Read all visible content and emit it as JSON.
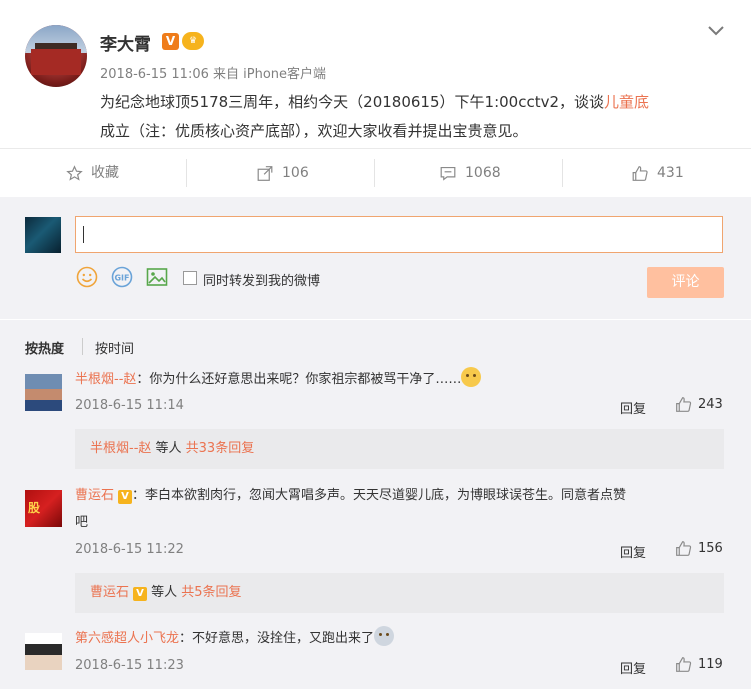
{
  "post": {
    "author": "李大霄",
    "verified_badge": "V",
    "meta": "2018-6-15 11:06 来自 iPhone客户端",
    "text_part1": "为纪念地球顶5178三周年，相约今天（20180615）下午1:00cctv2，谈谈",
    "text_link": "儿童底",
    "text_part2": "成立（注：优质核心资产底部），欢迎大家收看并提出宝贵意见。"
  },
  "actions": {
    "favorite": "收藏",
    "repost": "106",
    "comment": "1068",
    "like": "431"
  },
  "composer": {
    "input_value": "",
    "forward_label": "同时转发到我的微博",
    "submit": "评论"
  },
  "sort": {
    "hot": "按热度",
    "time": "按时间"
  },
  "comments": [
    {
      "name": "半根烟--赵",
      "sep": "：",
      "text": "你为什么还好意思出来呢？你家祖宗都被骂干净了……",
      "time": "2018-6-15 11:14",
      "reply": "回复",
      "likes": "243",
      "sub_name": "半根烟--赵",
      "sub_mid": " 等人 ",
      "sub_count": "共33条回复"
    },
    {
      "name": "曹运石",
      "sep": "：",
      "text_line1": "李白本欲割肉行，忽闻大霄唱多声。天天尽道婴儿底，为博眼球误苍生。同意者点赞",
      "text_line2": "吧",
      "time": "2018-6-15 11:22",
      "reply": "回复",
      "likes": "156",
      "sub_name": "曹运石",
      "sub_mid": " 等人 ",
      "sub_count": "共5条回复"
    },
    {
      "name": "第六感超人小飞龙",
      "sep": "：",
      "text": "不好意思，没拴住，又跑出来了",
      "time": "2018-6-15 11:23",
      "reply": "回复",
      "likes": "119"
    }
  ],
  "colors": {
    "accent": "#eb7350",
    "submit_disabled": "#ffc09f",
    "panel_bg": "#f2f2f5"
  }
}
